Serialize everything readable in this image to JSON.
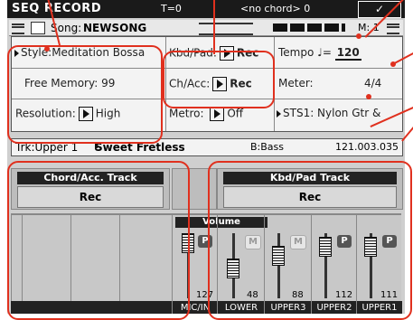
{
  "title": {
    "mode": "SEQ RECORD",
    "time": "T=0",
    "chord": "<no chord> 0",
    "ok": "✓"
  },
  "song": {
    "prefix": "Song:",
    "name": "NEWSONG",
    "measure": "M: 1"
  },
  "params": {
    "style_label": "Style:",
    "style_value": "Meditation Bossa",
    "free_memory_label": "Free Memory:",
    "free_memory_value": "99",
    "resolution_label": "Resolution:",
    "resolution_value": "High",
    "kbd_pad_label": "Kbd/Pad:",
    "kbd_pad_value": "Rec",
    "ch_acc_label": "Ch/Acc:",
    "ch_acc_value": "Rec",
    "metro_label": "Metro:",
    "metro_value": "Off",
    "tempo_label": "Tempo",
    "tempo_symbol": "♩=",
    "tempo_value": "120",
    "meter_label": "Meter:",
    "meter_value": "4/4",
    "sts_value": "STS1: Nylon Gtr &"
  },
  "track_info": {
    "track": "Trk:Upper 1",
    "sound": "Sweet Fretless",
    "bass": "B:Bass",
    "position": "121.003.035"
  },
  "chord_track": {
    "header": "Chord/Acc. Track",
    "button": "Rec"
  },
  "kbd_track": {
    "header": "Kbd/Pad Track",
    "button": "Rec"
  },
  "mixer": {
    "volume_header": "Volume",
    "channels": [
      {
        "name": "MIC/IN",
        "button": "P",
        "volume": "127",
        "muted": false
      },
      {
        "name": "LOWER",
        "button": "M",
        "volume": "48",
        "muted": true
      },
      {
        "name": "UPPER3",
        "button": "M",
        "volume": "88",
        "muted": true
      },
      {
        "name": "UPPER2",
        "button": "P",
        "volume": "112",
        "muted": false
      },
      {
        "name": "UPPER1",
        "button": "P",
        "volume": "111",
        "muted": false
      }
    ]
  },
  "colors": {
    "callout": "#e0301e",
    "titlebar": "#1a1a1a",
    "panel": "#f3f3f3"
  }
}
